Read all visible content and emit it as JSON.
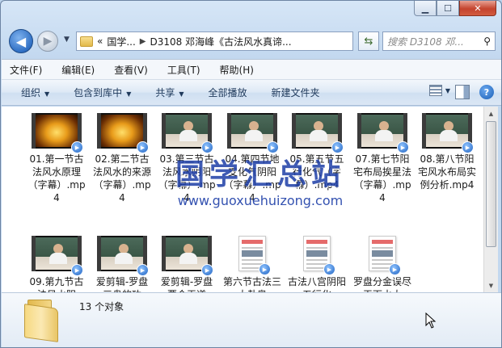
{
  "window": {
    "caption_buttons": [
      "minimize",
      "maximize",
      "close"
    ]
  },
  "address": {
    "overflow": "«",
    "crumbs": [
      "国学...",
      "D3108 邓海峰《古法风水真谛..."
    ]
  },
  "search": {
    "placeholder": "搜索 D3108 邓..."
  },
  "menu": [
    "文件(F)",
    "编辑(E)",
    "查看(V)",
    "工具(T)",
    "帮助(H)"
  ],
  "toolbar": {
    "organize": "组织",
    "include": "包含到库中",
    "share": "共享",
    "play_all": "全部播放",
    "new_folder": "新建文件夹"
  },
  "watermark": {
    "line1": "国学汇总站",
    "line2": "www.guoxuehuizong.com"
  },
  "files": [
    {
      "name": "01.第一节古法风水原理（字幕）.mp4",
      "thumb": "gold"
    },
    {
      "name": "02.第二节古法风水的来源（字幕）.mp4",
      "thumb": "gold"
    },
    {
      "name": "03.第三节古法风水阴阳（字幕）.mp4",
      "thumb": "class"
    },
    {
      "name": "04.第四节地支化气阴阳（字幕）.mp4",
      "thumb": "class"
    },
    {
      "name": "05.第五节五行化气（字幕）.mp4",
      "thumb": "class"
    },
    {
      "name": "07.第七节阳宅布局挨星法（字幕）.mp4",
      "thumb": "class"
    },
    {
      "name": "08.第八节阳宅风水布局实例分析.mp4",
      "thumb": "class"
    },
    {
      "name": "09.第九节古法风水阴",
      "thumb": "class"
    },
    {
      "name": "爱剪辑-罗盘三盘的功",
      "thumb": "class"
    },
    {
      "name": "爱剪辑-罗盘要合天道",
      "thumb": "class"
    },
    {
      "name": "第六节古法三大卦奥",
      "thumb": "doc"
    },
    {
      "name": "古法八宫阴阳五行化",
      "thumb": "doc"
    },
    {
      "name": "罗盘分金误尽天下水大",
      "thumb": "doc"
    }
  ],
  "details": {
    "count": "13 个对象"
  }
}
